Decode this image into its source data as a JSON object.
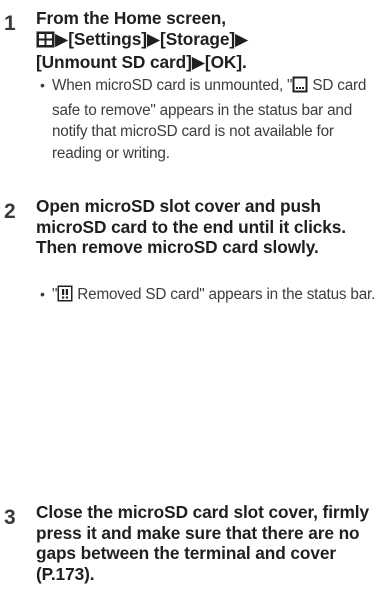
{
  "steps": [
    {
      "number": "1",
      "title_line1": "From the Home screen,",
      "title_line2": "▶[Settings]▶[Storage]▶",
      "title_line3": "[Unmount SD card]▶[OK].",
      "menu_icon": "apps-grid-icon",
      "note_prefix": "When microSD card is unmounted, \"",
      "note_icon": "sd-card-safe-remove-icon",
      "note_suffix": "SD card safe to remove\" appears in the status bar and notify that microSD card is not available for reading or writing."
    },
    {
      "number": "2",
      "title": "Open microSD slot cover and push microSD card to the end until it clicks. Then remove microSD card slowly.",
      "note_prefix": "\"",
      "note_icon": "sd-card-removed-warning-icon",
      "note_suffix": " Removed SD card\" appears in the status bar."
    },
    {
      "number": "3",
      "title": "Close the microSD card slot cover, firmly press it and make sure that there are no gaps between the terminal and cover (P.173)."
    }
  ],
  "bullet_char": "•",
  "colors": {
    "text": "#1f1f1f",
    "note_text": "#3d3d3d"
  }
}
